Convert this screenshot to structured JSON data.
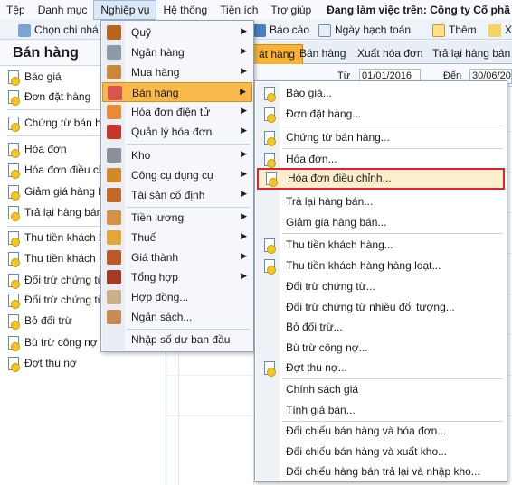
{
  "menubar": {
    "items": [
      "Tệp",
      "Danh mục",
      "Nghiệp vụ",
      "Hệ thống",
      "Tiện ích",
      "Trợ giúp"
    ],
    "working_on": "Đang làm việc trên: Công ty Cổ phầ"
  },
  "toolbar": {
    "choose": "Chọn chi nhá",
    "report": "Báo cáo",
    "posting_date": "Ngày hạch toán",
    "add": "Thêm",
    "x": "X"
  },
  "left_panel": {
    "title": "Bán hàng",
    "items": [
      "Báo giá",
      "Đơn đặt hàng",
      "Chứng từ bán hà",
      "Hóa đơn",
      "Hóa đơn điều ch",
      "Giảm giá hàng b",
      "Trả lại hàng bán",
      "Thu tiền khách h",
      "Thu tiền khách",
      "Đối trừ chứng từ",
      "Đối trừ chứng từ",
      "Bỏ đối trừ",
      "Bù trừ công nợ",
      "Đợt thu nợ"
    ]
  },
  "tabs": [
    "át hàng",
    "Bán hàng",
    "Xuất hóa đơn",
    "Trả lại hàng bán"
  ],
  "filter": {
    "from_label": "Từ",
    "from_value": "01/01/2016",
    "to_label": "Đến",
    "to_value": "30/06/20"
  },
  "menu": {
    "items": [
      "Quỹ",
      "Ngân hàng",
      "Mua hàng",
      "Bán hàng",
      "Hóa đơn điện tử",
      "Quản lý hóa đơn",
      "Kho",
      "Công cụ dụng cụ",
      "Tài sản cố định",
      "Tiền lương",
      "Thuế",
      "Giá thành",
      "Tổng hợp",
      "Hợp đồng...",
      "Ngân sách...",
      "Nhập số dư ban đầu"
    ],
    "highlighted": "Bán hàng"
  },
  "submenu": {
    "items": [
      "Báo giá...",
      "Đơn đặt hàng...",
      "Chứng từ bán hàng...",
      "Hóa đơn...",
      "Hóa đơn điều chỉnh...",
      "Trả lại hàng bán...",
      "Giảm giá hàng bán...",
      "Thu tiền khách hàng...",
      "Thu tiền khách hàng hàng loạt...",
      "Đối trừ chứng từ...",
      "Đối trừ chứng từ nhiều đối tượng...",
      "Bỏ đối trừ...",
      "Bù trừ công nợ...",
      "Đợt thu nợ...",
      "Chính sách giá",
      "Tính giá bán...",
      "Đối chiếu bán hàng và hóa đơn...",
      "Đối chiếu bán hàng và xuất kho...",
      "Đối chiếu hàng bán trả lại và nhập kho..."
    ],
    "highlighted": "Hóa đơn điều chỉnh..."
  },
  "colors": {
    "highlight": "#f9b84a",
    "annotation_box": "#e0222b",
    "active_tab": "#f9b233"
  }
}
